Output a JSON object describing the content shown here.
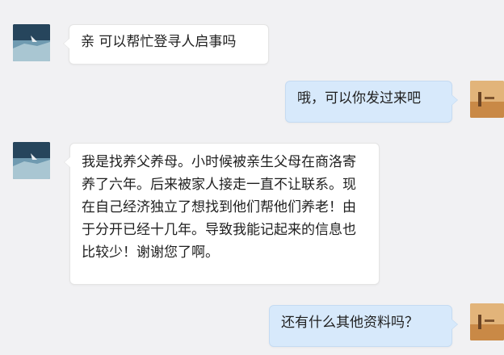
{
  "conversation": {
    "messages": [
      {
        "direction": "incoming",
        "avatar_icon": "landscape-avatar-icon",
        "text": "亲 可以帮忙登寻人启事吗"
      },
      {
        "direction": "outgoing",
        "avatar_icon": "sunset-avatar-icon",
        "text": "哦，可以你发过来吧"
      },
      {
        "direction": "incoming",
        "avatar_icon": "landscape-avatar-icon",
        "text": "我是找养父养母。小时候被亲生父母在商洛寄养了六年。后来被家人接走一直不让联系。现在自己经济独立了想找到他们帮他们养老！由于分开已经十几年。导致我能记起来的信息也比较少！谢谢您了啊。"
      },
      {
        "direction": "outgoing",
        "avatar_icon": "sunset-avatar-icon",
        "text": "还有什么其他资料吗？"
      }
    ]
  },
  "colors": {
    "background": "#f1f1f3",
    "incoming_bubble": "#ffffff",
    "outgoing_bubble": "#d7e9fb",
    "text": "#1f1f1f"
  }
}
